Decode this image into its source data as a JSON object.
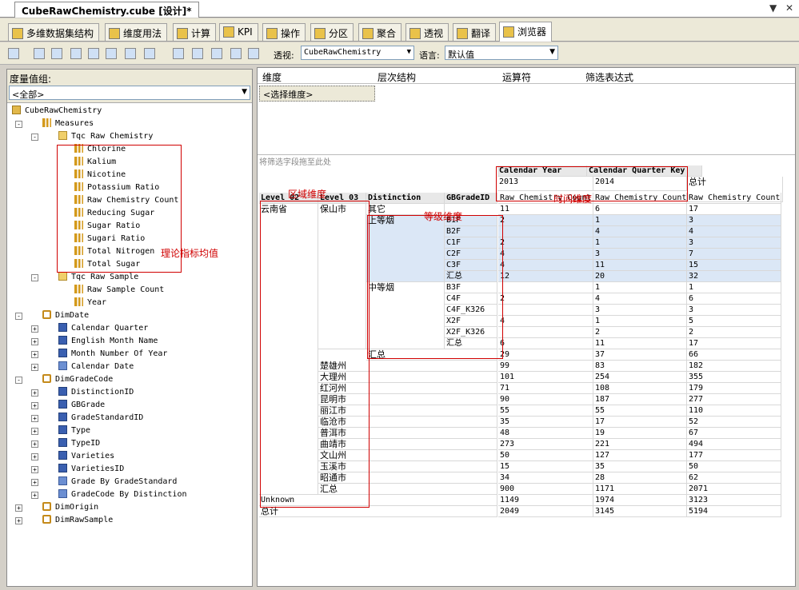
{
  "document": {
    "tab_title": "CubeRawChemistry.cube [设计]*"
  },
  "tabs": [
    "多维数据集结构",
    "维度用法",
    "计算",
    "KPI",
    "操作",
    "分区",
    "聚合",
    "透视",
    "翻译",
    "浏览器"
  ],
  "active_tab": "浏览器",
  "toolbar": {
    "perspective_label": "透视:",
    "perspective_value": "CubeRawChemistry",
    "language_label": "语言:",
    "language_value": "默认值"
  },
  "left_panel": {
    "measure_group_label": "度量值组:",
    "measure_group_value": "<全部>",
    "tree": [
      {
        "label": "CubeRawChemistry",
        "level": 0,
        "icon": "cube-icon"
      },
      {
        "label": "Measures",
        "level": 1,
        "icon": "measures-icon",
        "exp": "-"
      },
      {
        "label": "Tqc Raw Chemistry",
        "level": 2,
        "icon": "folder-icon",
        "exp": "-"
      },
      {
        "label": "Chlorine",
        "level": 3,
        "icon": "measure-icon"
      },
      {
        "label": "Kalium",
        "level": 3,
        "icon": "measure-icon"
      },
      {
        "label": "Nicotine",
        "level": 3,
        "icon": "measure-icon"
      },
      {
        "label": "Potassium Ratio",
        "level": 3,
        "icon": "measure-icon"
      },
      {
        "label": "Raw Chemistry Count",
        "level": 3,
        "icon": "measure-icon"
      },
      {
        "label": "Reducing Sugar",
        "level": 3,
        "icon": "measure-icon"
      },
      {
        "label": "Sugar Ratio",
        "level": 3,
        "icon": "measure-icon"
      },
      {
        "label": "Sugari Ratio",
        "level": 3,
        "icon": "measure-icon"
      },
      {
        "label": "Total Nitrogen",
        "level": 3,
        "icon": "measure-icon"
      },
      {
        "label": "Total Sugar",
        "level": 3,
        "icon": "measure-icon"
      },
      {
        "label": "Tqc Raw Sample",
        "level": 2,
        "icon": "folder-icon",
        "exp": "-"
      },
      {
        "label": "Raw Sample Count",
        "level": 3,
        "icon": "measure-icon"
      },
      {
        "label": "Year",
        "level": 3,
        "icon": "measure-icon"
      },
      {
        "label": "DimDate",
        "level": 1,
        "icon": "dimension-icon",
        "exp": "-"
      },
      {
        "label": "Calendar Quarter",
        "level": 2,
        "icon": "attribute-icon",
        "exp": "+"
      },
      {
        "label": "English Month Name",
        "level": 2,
        "icon": "attribute-icon",
        "exp": "+"
      },
      {
        "label": "Month Number Of Year",
        "level": 2,
        "icon": "attribute-icon",
        "exp": "+"
      },
      {
        "label": "Calendar Date",
        "level": 2,
        "icon": "hierarchy-icon",
        "exp": "+"
      },
      {
        "label": "DimGradeCode",
        "level": 1,
        "icon": "dimension-icon",
        "exp": "-"
      },
      {
        "label": "DistinctionID",
        "level": 2,
        "icon": "attribute-icon",
        "exp": "+"
      },
      {
        "label": "GBGrade",
        "level": 2,
        "icon": "attribute-icon",
        "exp": "+"
      },
      {
        "label": "GradeStandardID",
        "level": 2,
        "icon": "attribute-icon",
        "exp": "+"
      },
      {
        "label": "Type",
        "level": 2,
        "icon": "attribute-icon",
        "exp": "+"
      },
      {
        "label": "TypeID",
        "level": 2,
        "icon": "attribute-icon",
        "exp": "+"
      },
      {
        "label": "Varieties",
        "level": 2,
        "icon": "attribute-icon",
        "exp": "+"
      },
      {
        "label": "VarietiesID",
        "level": 2,
        "icon": "attribute-icon",
        "exp": "+"
      },
      {
        "label": "Grade By GradeStandard",
        "level": 2,
        "icon": "hierarchy-icon",
        "exp": "+"
      },
      {
        "label": "GradeCode By Distinction",
        "level": 2,
        "icon": "hierarchy-icon",
        "exp": "+"
      },
      {
        "label": "DimOrigin",
        "level": 1,
        "icon": "dimension-icon",
        "exp": "+"
      },
      {
        "label": "DimRawSample",
        "level": 1,
        "icon": "dimension-icon",
        "exp": "+"
      }
    ]
  },
  "filter_pane": {
    "headers": [
      "维度",
      "层次结构",
      "运算符",
      "筛选表达式"
    ],
    "select_dimension": "<选择维度>",
    "drop_hint": "将筛选字段拖至此处"
  },
  "pivot": {
    "col_fields": [
      "Calendar Year",
      "Calendar Quarter Key"
    ],
    "years": [
      "2013",
      "2014"
    ],
    "grand_total_col": "总计",
    "row_fields": [
      "Level 02",
      "Level 03",
      "Distinction",
      "GBGradeID"
    ],
    "measure_header": "Raw Chemistry Count",
    "province": "云南省",
    "city": "保山市",
    "other_label": "其它",
    "upper_label": "上等烟",
    "middle_label": "中等烟",
    "subtotal_label": "汇总",
    "unknown_label": "Unknown",
    "grand_total_row": "总计",
    "rows": [
      {
        "key": "other",
        "v": [
          "11",
          "6",
          "17"
        ]
      },
      {
        "key": "B1F",
        "v": [
          "2",
          "1",
          "3"
        ]
      },
      {
        "key": "B2F",
        "v": [
          "",
          "4",
          "4"
        ]
      },
      {
        "key": "C1F",
        "v": [
          "2",
          "1",
          "3"
        ]
      },
      {
        "key": "C2F",
        "v": [
          "4",
          "3",
          "7"
        ]
      },
      {
        "key": "C3F",
        "v": [
          "4",
          "11",
          "15"
        ]
      },
      {
        "key": "upper_sub",
        "v": [
          "12",
          "20",
          "32"
        ]
      },
      {
        "key": "B3F",
        "v": [
          "",
          "1",
          "1"
        ]
      },
      {
        "key": "C4F",
        "v": [
          "2",
          "4",
          "6"
        ]
      },
      {
        "key": "C4F_K326",
        "v": [
          "",
          "3",
          "3"
        ]
      },
      {
        "key": "X2F",
        "v": [
          "4",
          "1",
          "5"
        ]
      },
      {
        "key": "X2F_K326",
        "v": [
          "",
          "2",
          "2"
        ]
      },
      {
        "key": "mid_sub",
        "v": [
          "6",
          "11",
          "17"
        ]
      },
      {
        "key": "city_sub",
        "v": [
          "29",
          "37",
          "66"
        ]
      },
      {
        "key": "楚雄州",
        "v": [
          "99",
          "83",
          "182"
        ]
      },
      {
        "key": "大理州",
        "v": [
          "101",
          "254",
          "355"
        ]
      },
      {
        "key": "红河州",
        "v": [
          "71",
          "108",
          "179"
        ]
      },
      {
        "key": "昆明市",
        "v": [
          "90",
          "187",
          "277"
        ]
      },
      {
        "key": "丽江市",
        "v": [
          "55",
          "55",
          "110"
        ]
      },
      {
        "key": "临沧市",
        "v": [
          "35",
          "17",
          "52"
        ]
      },
      {
        "key": "普洱市",
        "v": [
          "48",
          "19",
          "67"
        ]
      },
      {
        "key": "曲靖市",
        "v": [
          "273",
          "221",
          "494"
        ]
      },
      {
        "key": "文山州",
        "v": [
          "50",
          "127",
          "177"
        ]
      },
      {
        "key": "玉溪市",
        "v": [
          "15",
          "35",
          "50"
        ]
      },
      {
        "key": "昭通市",
        "v": [
          "34",
          "28",
          "62"
        ]
      },
      {
        "key": "prov_sub",
        "v": [
          "900",
          "1171",
          "2071"
        ]
      },
      {
        "key": "unknown",
        "v": [
          "1149",
          "1974",
          "3123"
        ]
      },
      {
        "key": "total",
        "v": [
          "2049",
          "3145",
          "5194"
        ]
      }
    ],
    "grade_codes": [
      "B1F",
      "B2F",
      "C1F",
      "C2F",
      "C3F",
      "汇总",
      "B3F",
      "C4F",
      "C4F_K326",
      "X2F",
      "X2F_K326",
      "汇总"
    ],
    "other_cities": [
      "楚雄州",
      "大理州",
      "红河州",
      "昆明市",
      "丽江市",
      "临沧市",
      "普洱市",
      "曲靖市",
      "文山州",
      "玉溪市",
      "昭通市"
    ]
  },
  "annotations": {
    "measures_note": "理论指标均值",
    "region_note": "区域维度",
    "time_note": "时间维度",
    "grade_note": "等级维度"
  },
  "colors": {
    "annotation": "#d00000",
    "selection": "#dbe7f6"
  }
}
